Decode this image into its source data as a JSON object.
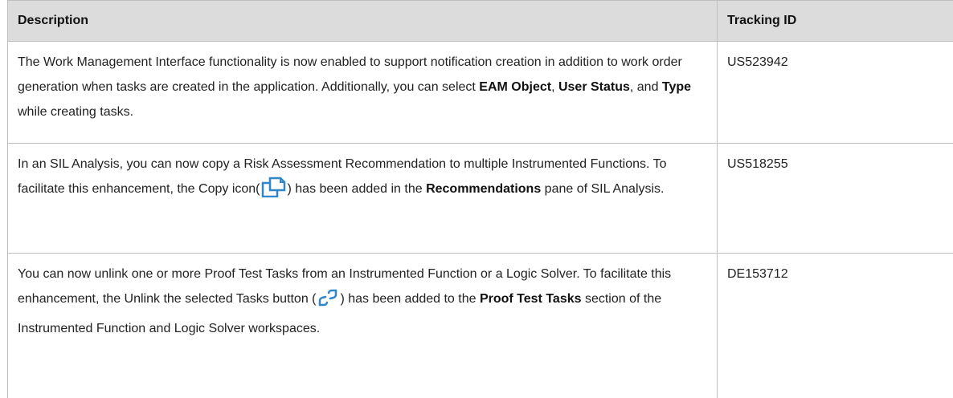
{
  "table": {
    "headers": {
      "description": "Description",
      "tracking_id": "Tracking ID"
    },
    "rows": [
      {
        "text_1": "The Work Management Interface functionality is now enabled to support notification creation in addition to work order generation when tasks are created in the application. Additionally, you can select ",
        "bold_1": "EAM Object",
        "text_2": ", ",
        "bold_2": "User Status",
        "text_3": ", and ",
        "bold_3": "Type",
        "text_4": " while creating tasks.",
        "tracking_id": "US523942"
      },
      {
        "text_1": "In an SIL Analysis, you can now copy a Risk Assessment Recommendation to multiple Instrumented Functions. To facilitate this enhancement, the Copy icon(",
        "icon": "copy-icon",
        "text_2": ") has been added in the ",
        "bold_1": "Recommendations",
        "text_3": " pane of SIL Analysis.",
        "tracking_id": "US518255"
      },
      {
        "text_1": "You can now unlink one or more Proof Test Tasks from an Instrumented Function or a Logic Solver. To facilitate this enhancement, the Unlink the selected Tasks button (",
        "icon": "unlink-icon",
        "text_2": ") has been added to the ",
        "bold_1": "Proof Test Tasks",
        "text_3": " section of the Instrumented Function and Logic Solver workspaces.",
        "tracking_id": "DE153712"
      }
    ]
  },
  "colors": {
    "header_bg": "#dcdcdc",
    "border": "#bfbfbf",
    "icon_blue": "#2f86c9"
  }
}
